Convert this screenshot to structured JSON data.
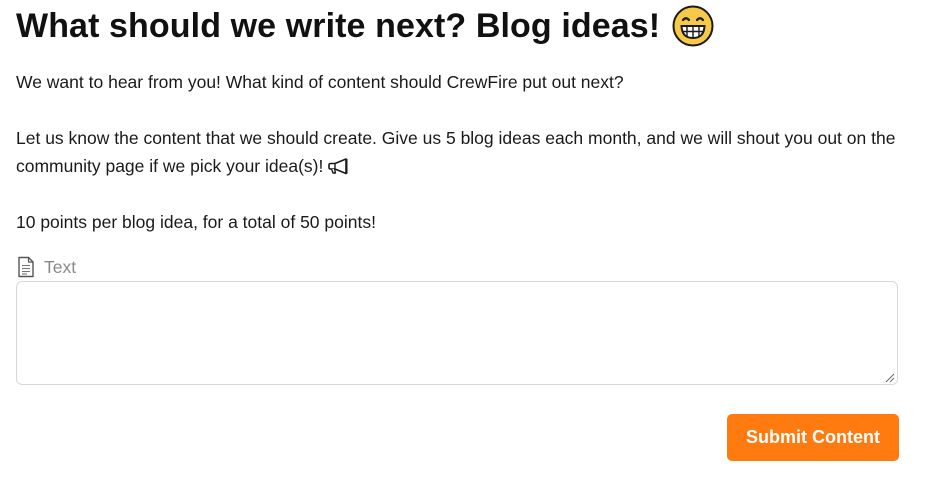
{
  "header": {
    "title": "What should we write next? Blog ideas!",
    "title_icon": "grinning-face-icon"
  },
  "content": {
    "intro": "We want to hear from you! What kind of content should CrewFire put out next?",
    "details": "Let us know the content that we should create. Give us 5 blog ideas each month, and we will shout you out on the community page if we pick your idea(s)!",
    "details_icon": "megaphone-icon",
    "points": "10 points per blog idea, for a total of 50 points!"
  },
  "form": {
    "field_label": "Text",
    "field_icon": "document-icon",
    "field_value": "",
    "submit_label": "Submit Content"
  },
  "colors": {
    "accent": "#ff7a0f",
    "text": "#1a1a1a",
    "label": "#8a8a8a",
    "border": "#d8d8d8"
  }
}
